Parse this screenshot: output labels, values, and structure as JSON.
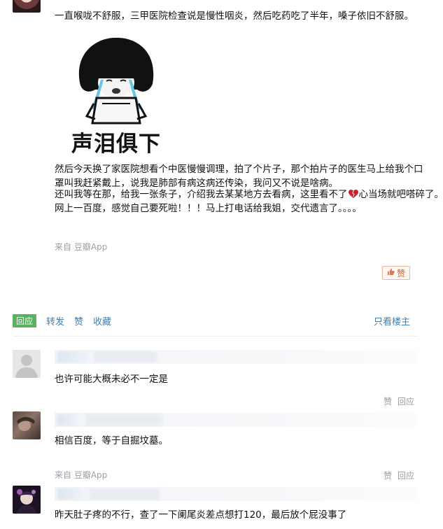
{
  "post": {
    "line1": "一直喉咙不舒服，三甲医院检查说是慢性咽炎，然后吃药吃了半年，嗓子依旧不舒服。",
    "meme_caption": "声泪俱下",
    "para2": "然后今天换了家医院想看个中医慢慢调理，拍了个片子，那个拍片子的医生马上给我个口罩叫我赶紧戴上，说我是肺部有病这病还传染，我问又不说是啥病。",
    "para3a": "还叫我等在那，给我一张条子，介绍我去某某地方去看病，这里看不了",
    "para3b": "心当场就吧嗒碎了。",
    "para4": "网上一百度，感觉自己要死啦！！！马上打电话给我姐，交代遗言了。。。。",
    "source": "来自 豆瓣App",
    "like_label": "赞"
  },
  "actions": {
    "reply": "回应",
    "share": "转发",
    "like": "赞",
    "collect": "收藏",
    "only_op": "只看楼主"
  },
  "comments": [
    {
      "text": "也许可能大概未必不一定是",
      "like": "赞",
      "reply": "回应"
    },
    {
      "text": "相信百度，等于自掘坟墓。",
      "source": "来自 豆瓣App",
      "like": "赞",
      "reply": "回应"
    },
    {
      "text": "昨天肚子疼的不行，查了一下阑尾炎差点想打120，最后放个屁没事了"
    }
  ],
  "colors": {
    "link": "#3f7fb5",
    "reply_tag": "#58b25f",
    "like_border": "#e8b9a0",
    "heart": "#c8232c"
  }
}
